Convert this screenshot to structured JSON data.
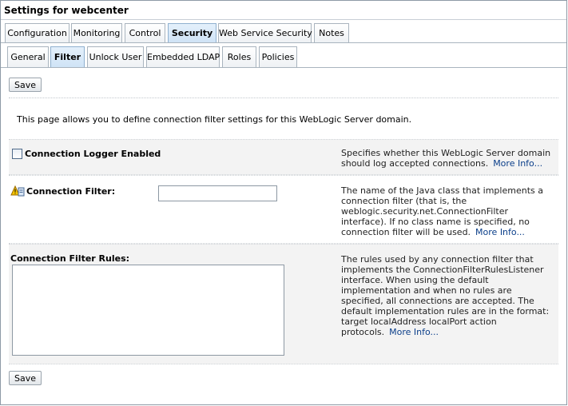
{
  "title": "Settings for webcenter",
  "main_tabs": [
    {
      "label": "Configuration"
    },
    {
      "label": "Monitoring"
    },
    {
      "label": "Control"
    },
    {
      "label": "Security"
    },
    {
      "label": "Web Service Security"
    },
    {
      "label": "Notes"
    }
  ],
  "active_main_tab": "Security",
  "sub_tabs": [
    {
      "label": "General"
    },
    {
      "label": "Filter"
    },
    {
      "label": "Unlock User"
    },
    {
      "label": "Embedded LDAP"
    },
    {
      "label": "Roles"
    },
    {
      "label": "Policies"
    }
  ],
  "active_sub_tab": "Filter",
  "save_label": "Save",
  "intro": "This page allows you to define connection filter settings for this WebLogic Server domain.",
  "connection_logger": {
    "label": "Connection Logger Enabled",
    "checked": false,
    "help": "Specifies whether this WebLogic Server domain should log accepted connections.",
    "more_info": "More Info..."
  },
  "connection_filter": {
    "label": "Connection Filter:",
    "value": "",
    "help": "The name of the Java class that implements a connection filter (that is, the weblogic.security.net.ConnectionFilter interface). If no class name is specified, no connection filter will be used.",
    "more_info": "More Info..."
  },
  "connection_filter_rules": {
    "label": "Connection Filter Rules:",
    "value": "",
    "help": "The rules used by any connection filter that implements the ConnectionFilterRulesListener interface. When using the default implementation and when no rules are specified, all connections are accepted. The default implementation rules are in the format: target localAddress localPort action protocols.",
    "more_info": "More Info..."
  },
  "colors": {
    "active_tab": "#cfe3f6",
    "section_bg": "#f3f3f3",
    "link": "#0b3f8a"
  },
  "icons": [
    "warning-icon"
  ]
}
